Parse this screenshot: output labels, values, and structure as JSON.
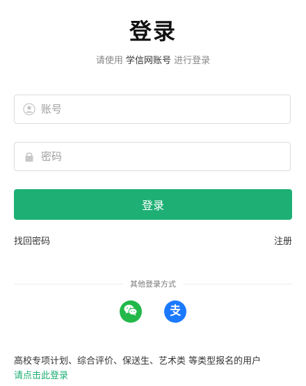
{
  "header": {
    "title": "登录",
    "subtitle_prefix": "请使用 ",
    "subtitle_strong": "学信网账号",
    "subtitle_suffix": " 进行登录"
  },
  "form": {
    "account_placeholder": "账号",
    "account_value": "",
    "password_placeholder": "密码",
    "password_value": "",
    "login_label": "登录"
  },
  "links": {
    "forgot_password": "找回密码",
    "register": "注册"
  },
  "social": {
    "divider_text": "其他登录方式",
    "icons": [
      "wechat-icon",
      "alipay-icon"
    ]
  },
  "footer": {
    "note": "高校专项计划、综合评价、保送生、艺术类 等类型报名的用户",
    "link": "请点击此登录"
  },
  "colors": {
    "accent": "#1daf74",
    "wechat": "#22b84a",
    "alipay": "#1b79ff"
  }
}
